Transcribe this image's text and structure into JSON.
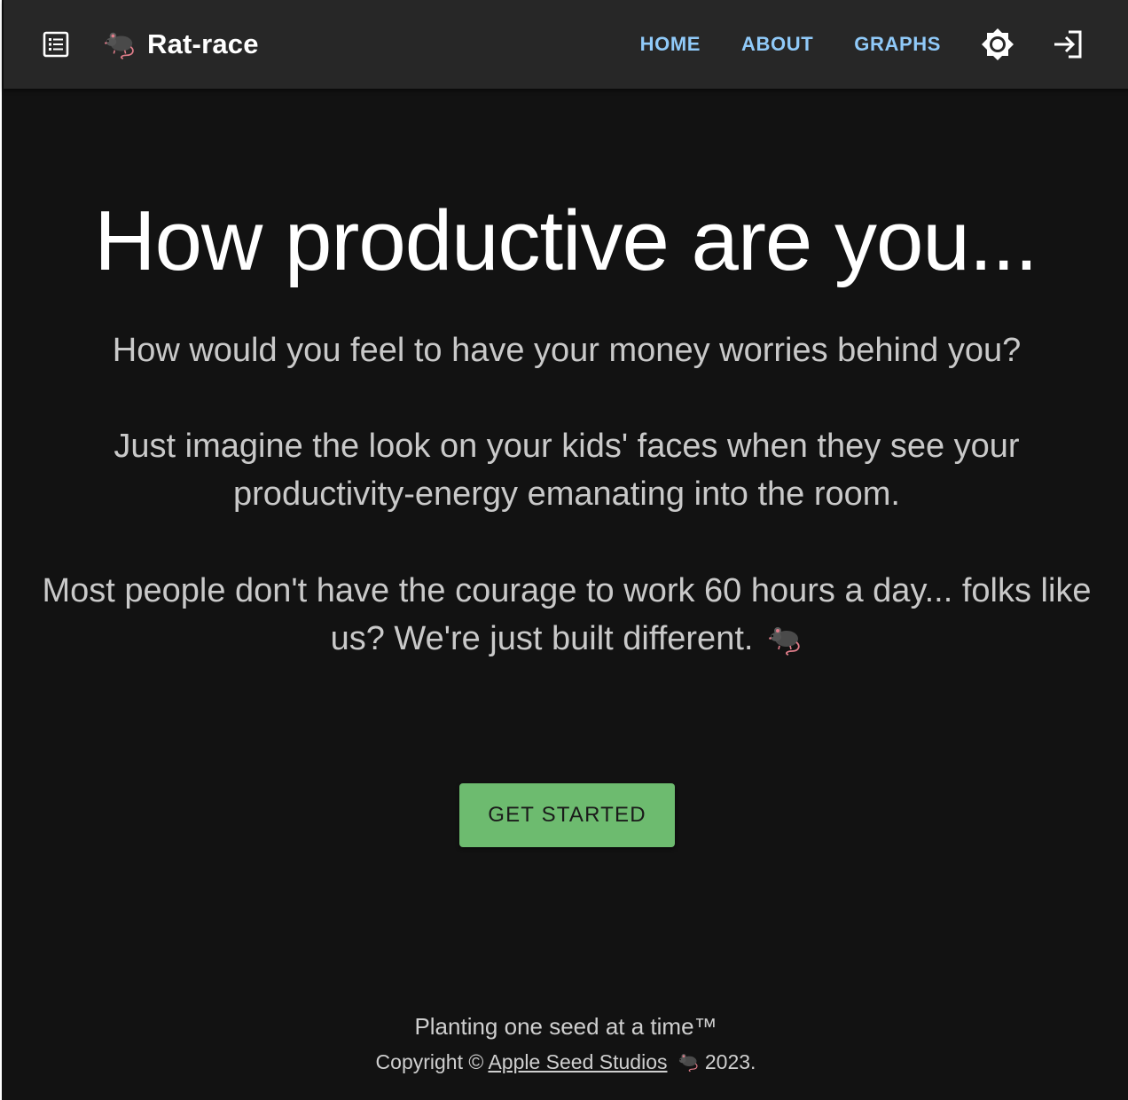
{
  "app": {
    "title": "Rat-race",
    "logo_icon": "rat-icon",
    "menu_icon": "list-menu-icon"
  },
  "nav": {
    "links": [
      {
        "label": "HOME"
      },
      {
        "label": "ABOUT"
      },
      {
        "label": "GRAPHS"
      }
    ],
    "theme_icon": "brightness-icon",
    "login_icon": "login-icon",
    "link_color": "#90caf9"
  },
  "hero": {
    "title": "How productive are you...",
    "paragraphs": [
      "How would you feel to have your money worries behind you?",
      "Just imagine the look on your kids' faces when they see your productivity-energy emanating into the room.",
      "Most people don't have the courage to work 60 hours a day... folks like us? We're just built different."
    ]
  },
  "cta": {
    "label": "GET STARTED",
    "color": "#6dbb6f"
  },
  "footer": {
    "tagline": "Planting one seed at a time™",
    "copyright_prefix": "Copyright ©",
    "company_link": "Apple Seed Studios",
    "year_suffix": "2023."
  },
  "colors": {
    "background": "#121212",
    "appbar": "#272727"
  }
}
